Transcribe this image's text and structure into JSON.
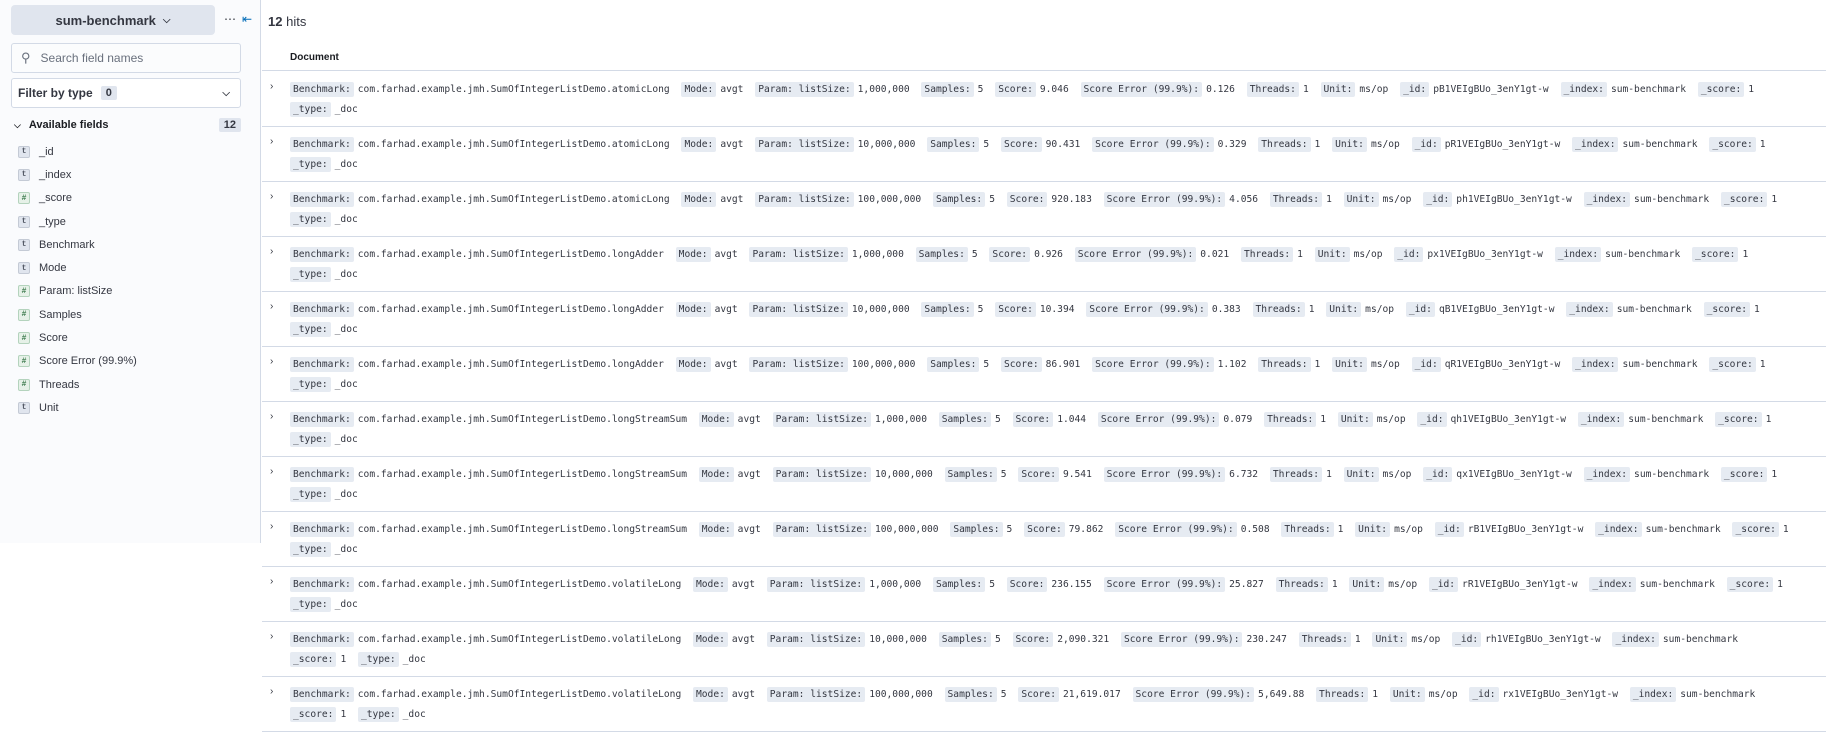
{
  "sidebar": {
    "index_pattern": "sum-benchmark",
    "search_placeholder": "Search field names",
    "filter_by_type_label": "Filter by type",
    "filter_by_type_count": "0",
    "available_fields_label": "Available fields",
    "available_fields_count": "12",
    "fields": [
      {
        "name": "_id",
        "type_icon": "t"
      },
      {
        "name": "_index",
        "type_icon": "t"
      },
      {
        "name": "_score",
        "type_icon": "#"
      },
      {
        "name": "_type",
        "type_icon": "t"
      },
      {
        "name": "Benchmark",
        "type_icon": "t"
      },
      {
        "name": "Mode",
        "type_icon": "t"
      },
      {
        "name": "Param: listSize",
        "type_icon": "#"
      },
      {
        "name": "Samples",
        "type_icon": "#"
      },
      {
        "name": "Score",
        "type_icon": "#"
      },
      {
        "name": "Score Error (99.9%)",
        "type_icon": "#"
      },
      {
        "name": "Threads",
        "type_icon": "#"
      },
      {
        "name": "Unit",
        "type_icon": "t"
      }
    ]
  },
  "main": {
    "hits_count": "12",
    "hits_label": "hits",
    "column_header": "Document",
    "documents": [
      [
        [
          "Benchmark:",
          "com.farhad.example.jmh.SumOfIntegerListDemo.atomicLong"
        ],
        [
          "Mode:",
          "avgt"
        ],
        [
          "Param: listSize:",
          "1,000,000"
        ],
        [
          "Samples:",
          "5"
        ],
        [
          "Score:",
          "9.046"
        ],
        [
          "Score Error (99.9%):",
          "0.126"
        ],
        [
          "Threads:",
          "1"
        ],
        [
          "Unit:",
          "ms/op"
        ],
        [
          "_id:",
          "pB1VEIgBUo_3enY1gt-w"
        ],
        [
          "_index:",
          "sum-benchmark"
        ],
        [
          "_score:",
          "1"
        ],
        [
          "_type:",
          "_doc"
        ]
      ],
      [
        [
          "Benchmark:",
          "com.farhad.example.jmh.SumOfIntegerListDemo.atomicLong"
        ],
        [
          "Mode:",
          "avgt"
        ],
        [
          "Param: listSize:",
          "10,000,000"
        ],
        [
          "Samples:",
          "5"
        ],
        [
          "Score:",
          "90.431"
        ],
        [
          "Score Error (99.9%):",
          "0.329"
        ],
        [
          "Threads:",
          "1"
        ],
        [
          "Unit:",
          "ms/op"
        ],
        [
          "_id:",
          "pR1VEIgBUo_3enY1gt-w"
        ],
        [
          "_index:",
          "sum-benchmark"
        ],
        [
          "_score:",
          "1"
        ],
        [
          "_type:",
          "_doc"
        ]
      ],
      [
        [
          "Benchmark:",
          "com.farhad.example.jmh.SumOfIntegerListDemo.atomicLong"
        ],
        [
          "Mode:",
          "avgt"
        ],
        [
          "Param: listSize:",
          "100,000,000"
        ],
        [
          "Samples:",
          "5"
        ],
        [
          "Score:",
          "920.183"
        ],
        [
          "Score Error (99.9%):",
          "4.056"
        ],
        [
          "Threads:",
          "1"
        ],
        [
          "Unit:",
          "ms/op"
        ],
        [
          "_id:",
          "ph1VEIgBUo_3enY1gt-w"
        ],
        [
          "_index:",
          "sum-benchmark"
        ],
        [
          "_score:",
          "1"
        ],
        [
          "_type:",
          "_doc"
        ]
      ],
      [
        [
          "Benchmark:",
          "com.farhad.example.jmh.SumOfIntegerListDemo.longAdder"
        ],
        [
          "Mode:",
          "avgt"
        ],
        [
          "Param: listSize:",
          "1,000,000"
        ],
        [
          "Samples:",
          "5"
        ],
        [
          "Score:",
          "0.926"
        ],
        [
          "Score Error (99.9%):",
          "0.021"
        ],
        [
          "Threads:",
          "1"
        ],
        [
          "Unit:",
          "ms/op"
        ],
        [
          "_id:",
          "px1VEIgBUo_3enY1gt-w"
        ],
        [
          "_index:",
          "sum-benchmark"
        ],
        [
          "_score:",
          "1"
        ],
        [
          "_type:",
          "_doc"
        ]
      ],
      [
        [
          "Benchmark:",
          "com.farhad.example.jmh.SumOfIntegerListDemo.longAdder"
        ],
        [
          "Mode:",
          "avgt"
        ],
        [
          "Param: listSize:",
          "10,000,000"
        ],
        [
          "Samples:",
          "5"
        ],
        [
          "Score:",
          "10.394"
        ],
        [
          "Score Error (99.9%):",
          "0.383"
        ],
        [
          "Threads:",
          "1"
        ],
        [
          "Unit:",
          "ms/op"
        ],
        [
          "_id:",
          "qB1VEIgBUo_3enY1gt-w"
        ],
        [
          "_index:",
          "sum-benchmark"
        ],
        [
          "_score:",
          "1"
        ],
        [
          "_type:",
          "_doc"
        ]
      ],
      [
        [
          "Benchmark:",
          "com.farhad.example.jmh.SumOfIntegerListDemo.longAdder"
        ],
        [
          "Mode:",
          "avgt"
        ],
        [
          "Param: listSize:",
          "100,000,000"
        ],
        [
          "Samples:",
          "5"
        ],
        [
          "Score:",
          "86.901"
        ],
        [
          "Score Error (99.9%):",
          "1.102"
        ],
        [
          "Threads:",
          "1"
        ],
        [
          "Unit:",
          "ms/op"
        ],
        [
          "_id:",
          "qR1VEIgBUo_3enY1gt-w"
        ],
        [
          "_index:",
          "sum-benchmark"
        ],
        [
          "_score:",
          "1"
        ],
        [
          "_type:",
          "_doc"
        ]
      ],
      [
        [
          "Benchmark:",
          "com.farhad.example.jmh.SumOfIntegerListDemo.longStreamSum"
        ],
        [
          "Mode:",
          "avgt"
        ],
        [
          "Param: listSize:",
          "1,000,000"
        ],
        [
          "Samples:",
          "5"
        ],
        [
          "Score:",
          "1.044"
        ],
        [
          "Score Error (99.9%):",
          "0.079"
        ],
        [
          "Threads:",
          "1"
        ],
        [
          "Unit:",
          "ms/op"
        ],
        [
          "_id:",
          "qh1VEIgBUo_3enY1gt-w"
        ],
        [
          "_index:",
          "sum-benchmark"
        ],
        [
          "_score:",
          "1"
        ],
        [
          "_type:",
          "_doc"
        ]
      ],
      [
        [
          "Benchmark:",
          "com.farhad.example.jmh.SumOfIntegerListDemo.longStreamSum"
        ],
        [
          "Mode:",
          "avgt"
        ],
        [
          "Param: listSize:",
          "10,000,000"
        ],
        [
          "Samples:",
          "5"
        ],
        [
          "Score:",
          "9.541"
        ],
        [
          "Score Error (99.9%):",
          "6.732"
        ],
        [
          "Threads:",
          "1"
        ],
        [
          "Unit:",
          "ms/op"
        ],
        [
          "_id:",
          "qx1VEIgBUo_3enY1gt-w"
        ],
        [
          "_index:",
          "sum-benchmark"
        ],
        [
          "_score:",
          "1"
        ],
        [
          "_type:",
          "_doc"
        ]
      ],
      [
        [
          "Benchmark:",
          "com.farhad.example.jmh.SumOfIntegerListDemo.longStreamSum"
        ],
        [
          "Mode:",
          "avgt"
        ],
        [
          "Param: listSize:",
          "100,000,000"
        ],
        [
          "Samples:",
          "5"
        ],
        [
          "Score:",
          "79.862"
        ],
        [
          "Score Error (99.9%):",
          "0.508"
        ],
        [
          "Threads:",
          "1"
        ],
        [
          "Unit:",
          "ms/op"
        ],
        [
          "_id:",
          "rB1VEIgBUo_3enY1gt-w"
        ],
        [
          "_index:",
          "sum-benchmark"
        ],
        [
          "_score:",
          "1"
        ],
        [
          "_type:",
          "_doc"
        ]
      ],
      [
        [
          "Benchmark:",
          "com.farhad.example.jmh.SumOfIntegerListDemo.volatileLong"
        ],
        [
          "Mode:",
          "avgt"
        ],
        [
          "Param: listSize:",
          "1,000,000"
        ],
        [
          "Samples:",
          "5"
        ],
        [
          "Score:",
          "236.155"
        ],
        [
          "Score Error (99.9%):",
          "25.827"
        ],
        [
          "Threads:",
          "1"
        ],
        [
          "Unit:",
          "ms/op"
        ],
        [
          "_id:",
          "rR1VEIgBUo_3enY1gt-w"
        ],
        [
          "_index:",
          "sum-benchmark"
        ],
        [
          "_score:",
          "1"
        ],
        [
          "_type:",
          "_doc"
        ]
      ],
      [
        [
          "Benchmark:",
          "com.farhad.example.jmh.SumOfIntegerListDemo.volatileLong"
        ],
        [
          "Mode:",
          "avgt"
        ],
        [
          "Param: listSize:",
          "10,000,000"
        ],
        [
          "Samples:",
          "5"
        ],
        [
          "Score:",
          "2,090.321"
        ],
        [
          "Score Error (99.9%):",
          "230.247"
        ],
        [
          "Threads:",
          "1"
        ],
        [
          "Unit:",
          "ms/op"
        ],
        [
          "_id:",
          "rh1VEIgBUo_3enY1gt-w"
        ],
        [
          "_index:",
          "sum-benchmark"
        ],
        [
          "_score:",
          "1"
        ],
        [
          "_type:",
          "_doc"
        ]
      ],
      [
        [
          "Benchmark:",
          "com.farhad.example.jmh.SumOfIntegerListDemo.volatileLong"
        ],
        [
          "Mode:",
          "avgt"
        ],
        [
          "Param: listSize:",
          "100,000,000"
        ],
        [
          "Samples:",
          "5"
        ],
        [
          "Score:",
          "21,619.017"
        ],
        [
          "Score Error (99.9%):",
          "5,649.88"
        ],
        [
          "Threads:",
          "1"
        ],
        [
          "Unit:",
          "ms/op"
        ],
        [
          "_id:",
          "rx1VEIgBUo_3enY1gt-w"
        ],
        [
          "_index:",
          "sum-benchmark"
        ],
        [
          "_score:",
          "1"
        ],
        [
          "_type:",
          "_doc"
        ]
      ]
    ]
  }
}
